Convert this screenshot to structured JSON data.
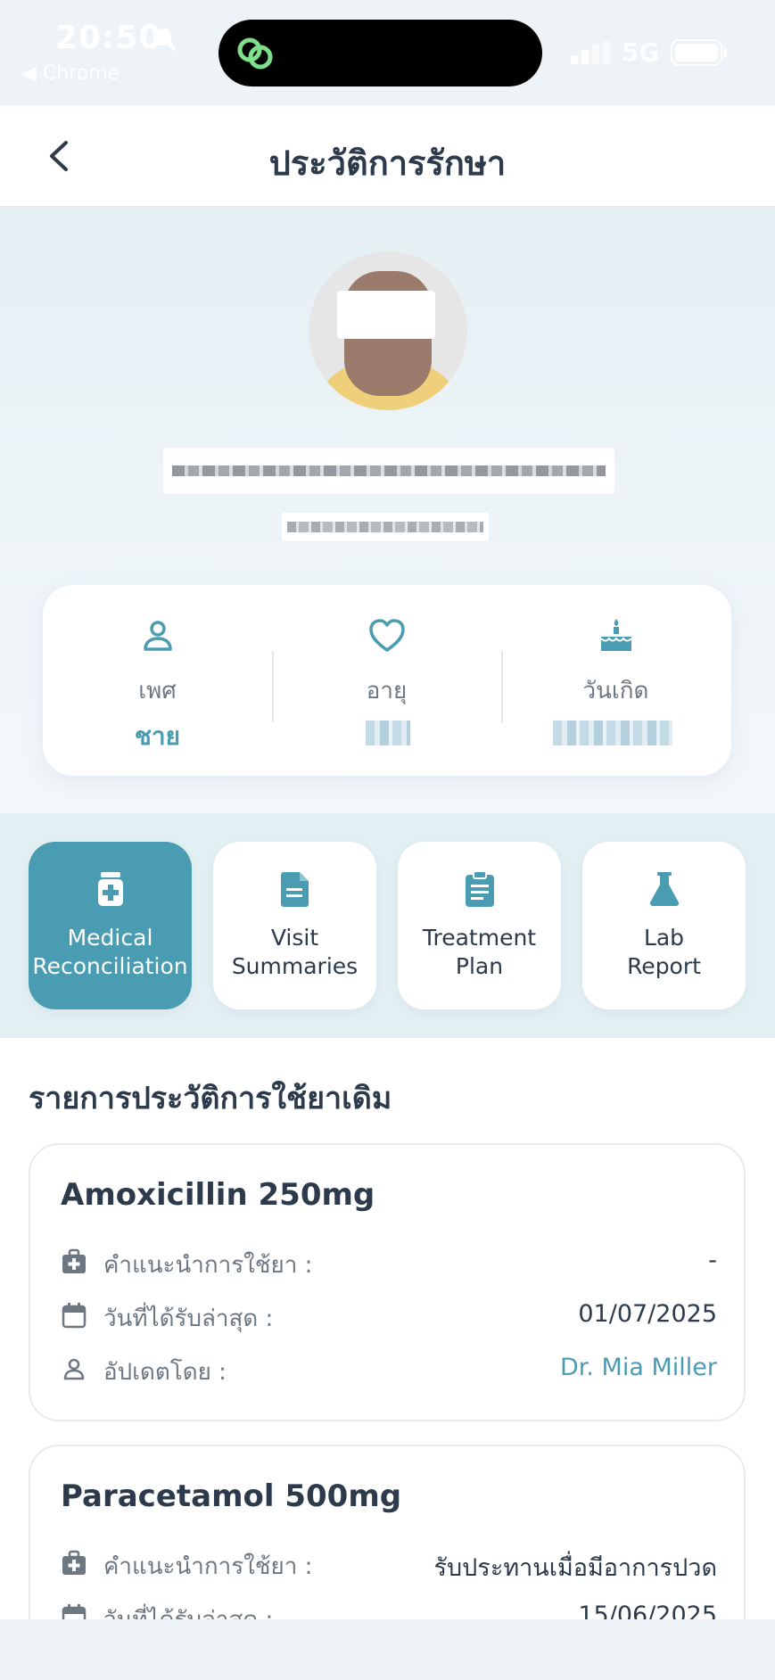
{
  "status_bar": {
    "time": "20:50",
    "back_app": "◀ Chrome",
    "network": "5G"
  },
  "header": {
    "title": "ประวัติการรักษา"
  },
  "profile": {
    "info": [
      {
        "label": "เพศ",
        "value": "ชาย",
        "icon": "person-icon"
      },
      {
        "label": "อายุ",
        "value": "",
        "icon": "heart-icon"
      },
      {
        "label": "วันเกิด",
        "value": "",
        "icon": "cake-icon"
      }
    ]
  },
  "tabs": [
    {
      "label": "Medical\nReconciliation",
      "icon": "medicine-bottle-icon",
      "active": true
    },
    {
      "label": "Visit\nSummaries",
      "icon": "document-icon",
      "active": false
    },
    {
      "label": "Treatment\nPlan",
      "icon": "clipboard-icon",
      "active": false
    },
    {
      "label": "Lab\nReport",
      "icon": "flask-icon",
      "active": false
    }
  ],
  "section": {
    "title": "รายการประวัติการใช้ยาเดิม"
  },
  "medications": [
    {
      "name": "Amoxicillin 250mg",
      "instruction_label": "คำแนะนำการใช้ยา :",
      "instruction_value": "-",
      "date_label": "วันที่ได้รับล่าสุด :",
      "date_value": "01/07/2025",
      "updated_label": "อัปเดตโดย :",
      "updated_value": "Dr. Mia Miller"
    },
    {
      "name": "Paracetamol 500mg",
      "instruction_label": "คำแนะนำการใช้ยา :",
      "instruction_value": "รับประทานเมื่อมีอาการปวด",
      "date_label": "วันที่ได้รับล่าสุด :",
      "date_value": "15/06/2025"
    }
  ],
  "colors": {
    "accent": "#4a9cb2",
    "text_dark": "#2c3a4b",
    "text_muted": "#6d7782",
    "tab_strip_bg": "#e2eff3"
  }
}
